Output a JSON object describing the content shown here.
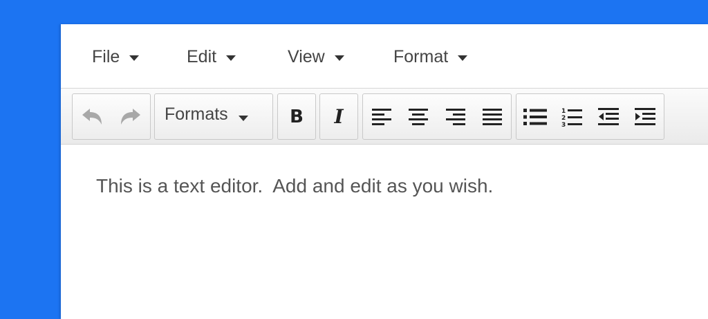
{
  "menubar": {
    "items": [
      {
        "label": "File"
      },
      {
        "label": "Edit"
      },
      {
        "label": "View"
      },
      {
        "label": "Format"
      }
    ]
  },
  "toolbar": {
    "formats_label": "Formats",
    "bold_label": "B",
    "italic_label": "I",
    "icons": [
      "undo-icon",
      "redo-icon",
      "align-left-icon",
      "align-center-icon",
      "align-right-icon",
      "align-justify-icon",
      "bullet-list-icon",
      "numbered-list-icon",
      "outdent-icon",
      "indent-icon"
    ]
  },
  "editor": {
    "text": "This is a text editor.  Add and edit as you wish."
  },
  "colors": {
    "background": "#1c74f2",
    "text": "#555555",
    "disabled_icon": "#a8a8a8"
  }
}
